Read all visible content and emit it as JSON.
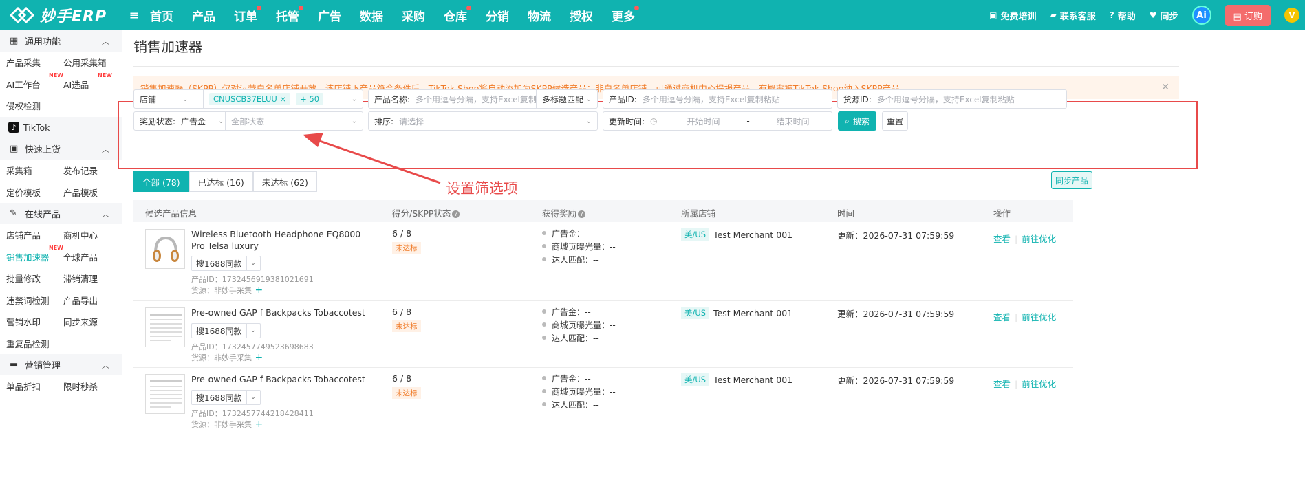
{
  "app": {
    "logo_text": "妙手ERP",
    "nav": [
      {
        "label": "首页",
        "dot": false
      },
      {
        "label": "产品",
        "dot": false
      },
      {
        "label": "订单",
        "dot": true
      },
      {
        "label": "托管",
        "dot": true
      },
      {
        "label": "广告",
        "dot": false
      },
      {
        "label": "数据",
        "dot": false
      },
      {
        "label": "采购",
        "dot": false
      },
      {
        "label": "仓库",
        "dot": true
      },
      {
        "label": "分销",
        "dot": false
      },
      {
        "label": "物流",
        "dot": false
      },
      {
        "label": "授权",
        "dot": false
      },
      {
        "label": "更多",
        "dot": true
      }
    ],
    "top_right": {
      "training": "免费培训",
      "support": "联系客服",
      "help": "帮助",
      "sync": "同步",
      "ai": "Ai",
      "order": "订购",
      "vip": "V"
    },
    "accent": "#10b3b0"
  },
  "sidebar": {
    "groups": [
      {
        "label": "通用功能",
        "icon": "grid-icon",
        "rows": [
          [
            "产品采集",
            "公用采集箱"
          ],
          [
            "AI工作台",
            "AI选品"
          ],
          [
            "侵权检测"
          ]
        ],
        "new": [
          "AI工作台",
          "AI选品"
        ]
      },
      {
        "tiktok": "TikTok"
      },
      {
        "label": "快速上货",
        "icon": "lock-icon",
        "rows": [
          [
            "采集箱",
            "发布记录"
          ],
          [
            "定价模板",
            "产品模板"
          ]
        ]
      },
      {
        "label": "在线产品",
        "icon": "edit-icon",
        "rows": [
          [
            "店铺产品",
            "商机中心"
          ],
          [
            "销售加速器",
            "全球产品"
          ],
          [
            "批量修改",
            "滞销清理"
          ],
          [
            "违禁词检测",
            "产品导出"
          ],
          [
            "营销水印",
            "同步来源"
          ],
          [
            "重复品检测"
          ]
        ],
        "new": [
          "销售加速器"
        ],
        "active": "销售加速器"
      },
      {
        "label": "营销管理",
        "icon": "ticket-icon",
        "rows": [
          [
            "单品折扣",
            "限时秒杀"
          ]
        ]
      }
    ],
    "new_label": "NEW"
  },
  "page": {
    "title": "销售加速器",
    "notice": "销售加速器（SKPP）仅对运营白名单店铺开放，该店铺下产品符合条件后，TikTok Shop将自动添加为SKPP候选产品；非白名单店铺，可通过商机中心提报产品，有概率被TikTok Shop纳入SKPP产品。",
    "annotation": "设置筛选项"
  },
  "filters": {
    "shop_label": "店铺",
    "shop_tag": "CNUSCB37ELUU",
    "shop_more": "+ 50",
    "product_name_label": "产品名称:",
    "product_name_placeholder": "多个用逗号分隔，支持Excel复制粘贴",
    "match_mode": "多标题匹配",
    "product_id_label": "产品ID:",
    "product_id_placeholder": "多个用逗号分隔，支持Excel复制粘贴",
    "source_id_label": "货源ID:",
    "source_id_placeholder": "多个用逗号分隔，支持Excel复制粘贴",
    "reward_label": "奖励状态:",
    "reward_value": "广告金",
    "status_placeholder": "全部状态",
    "sort_label": "排序:",
    "sort_placeholder": "请选择",
    "update_time_label": "更新时间:",
    "start_placeholder": "开始时间",
    "range_sep": "-",
    "end_placeholder": "结束时间",
    "search_btn": "搜索",
    "reset_btn": "重置"
  },
  "tabs": [
    {
      "label": "全部 (78)",
      "active": true
    },
    {
      "label": "已达标 (16)",
      "active": false
    },
    {
      "label": "未达标 (62)",
      "active": false
    }
  ],
  "sync_products": "同步产品",
  "table": {
    "headers": [
      "候选产品信息",
      "得分/SKPP状态",
      "获得奖励",
      "所属店铺",
      "时间",
      "操作"
    ],
    "rows": [
      {
        "name": "Wireless Bluetooth Headphone EQ8000 Pro Telsa luxury",
        "source_btn": "搜1688同款",
        "product_id": "产品ID：1732456919381021691",
        "source": "货源：非妙手采集",
        "score": "6 / 8",
        "status": "未达标",
        "rewards": [
          "广告金：--",
          "商城页曝光量：--",
          "达人匹配：--"
        ],
        "region": "美/US",
        "shop": "Test Merchant 001",
        "time": "更新：2026-07-31 07:59:59",
        "ops": [
          "查看",
          "前往优化"
        ],
        "thumb": "headphone"
      },
      {
        "name": "Pre-owned GAP f Backpacks Tobaccotest",
        "source_btn": "搜1688同款",
        "product_id": "产品ID：1732457749523698683",
        "source": "货源：非妙手采集",
        "score": "6 / 8",
        "status": "未达标",
        "rewards": [
          "广告金：--",
          "商城页曝光量：--",
          "达人匹配：--"
        ],
        "region": "美/US",
        "shop": "Test Merchant 001",
        "time": "更新：2026-07-31 07:59:59",
        "ops": [
          "查看",
          "前往优化"
        ],
        "thumb": "document"
      },
      {
        "name": "Pre-owned GAP f Backpacks Tobaccotest",
        "source_btn": "搜1688同款",
        "product_id": "产品ID：1732457744218428411",
        "source": "货源：非妙手采集",
        "score": "6 / 8",
        "status": "未达标",
        "rewards": [
          "广告金：--",
          "商城页曝光量：--",
          "达人匹配：--"
        ],
        "region": "美/US",
        "shop": "Test Merchant 001",
        "time": "更新：2026-07-31 07:59:59",
        "ops": [
          "查看",
          "前往优化"
        ],
        "thumb": "document"
      }
    ]
  }
}
